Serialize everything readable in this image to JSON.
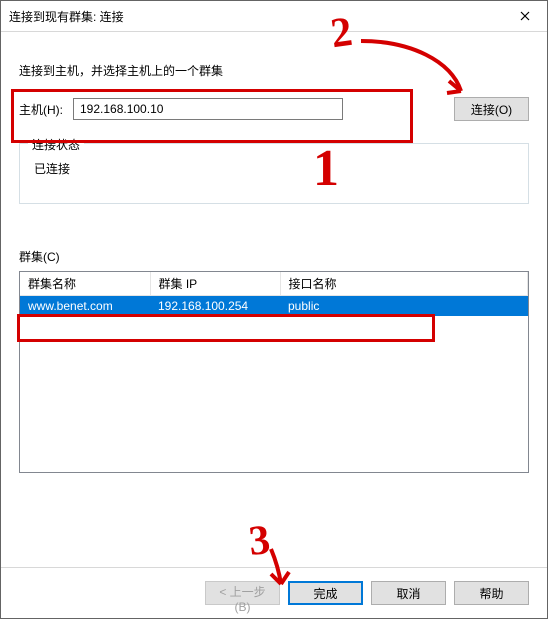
{
  "window": {
    "title": "连接到现有群集: 连接"
  },
  "lead": "连接到主机，并选择主机上的一个群集",
  "host": {
    "label": "主机(H):",
    "value": "192.168.100.10"
  },
  "connect_btn": "连接(O)",
  "status": {
    "legend": "连接状态",
    "text": "已连接"
  },
  "clusters": {
    "label": "群集(C)",
    "headers": {
      "name": "群集名称",
      "ip": "群集 IP",
      "iface": "接口名称"
    },
    "rows": [
      {
        "name": "www.benet.com",
        "ip": "192.168.100.254",
        "iface": "public"
      }
    ]
  },
  "footer": {
    "back": "< 上一步(B)",
    "finish": "完成",
    "cancel": "取消",
    "help": "帮助"
  },
  "anno": {
    "n1": "1",
    "n2": "2",
    "n3": "3"
  }
}
